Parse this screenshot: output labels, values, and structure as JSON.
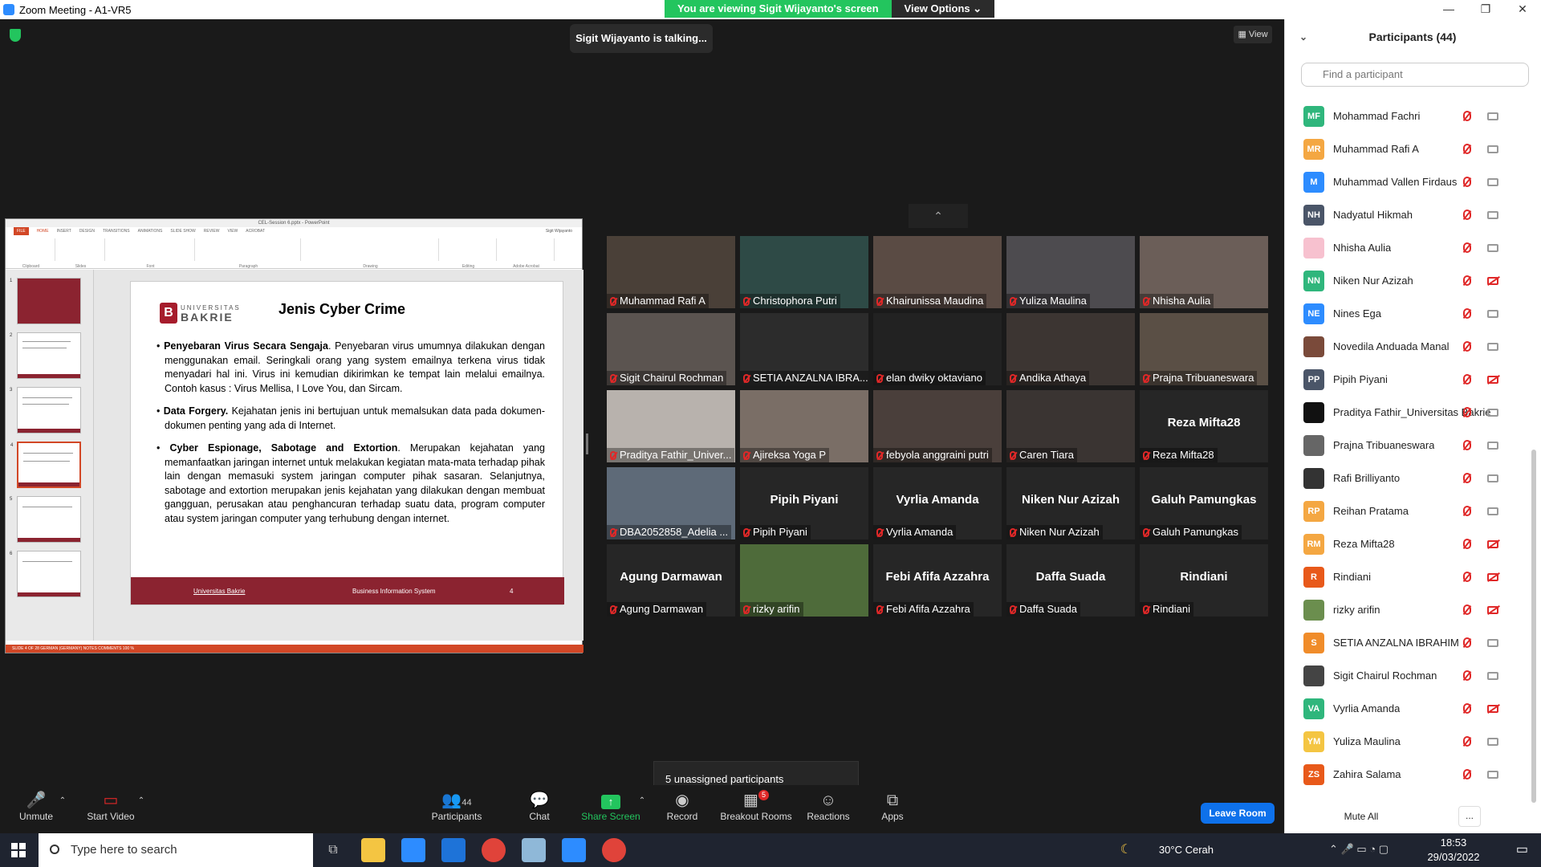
{
  "window": {
    "title": "Zoom Meeting - A1-VR5",
    "minimize": "—",
    "restore": "❐",
    "close": "✕"
  },
  "banner": {
    "viewing": "You are viewing Sigit Wijayanto's screen",
    "view_options": "View Options ⌄"
  },
  "talking": "Sigit Wijayanto is talking...",
  "view_button": "View",
  "share": {
    "app_title": "CEL-Session 6.pptx - PowerPoint",
    "ribbon_tabs": [
      "FILE",
      "HOME",
      "INSERT",
      "DESIGN",
      "TRANSITIONS",
      "ANIMATIONS",
      "SLIDE SHOW",
      "REVIEW",
      "VIEW",
      "ACROBAT"
    ],
    "user": "Sigit Wijayanto",
    "ribbon_groups": [
      "Clipboard",
      "Slides",
      "Font",
      "Paragraph",
      "Drawing",
      "Editing",
      "Adobe Acrobat"
    ],
    "logo_small": "UNIVERSITAS",
    "logo_big": "BAKRIE",
    "slide_title": "Jenis Cyber Crime",
    "bullets": [
      {
        "head": "Penyebaran Virus Secara Sengaja",
        "body": ". Penyebaran virus umumnya dilakukan dengan menggunakan email. Seringkali orang yang system emailnya terkena virus tidak menyadari hal ini. Virus ini kemudian dikirimkan ke tempat lain melalui emailnya. Contoh kasus : Virus Mellisa, I Love You, dan Sircam."
      },
      {
        "head": "Data Forgery.",
        "body": " Kejahatan jenis ini bertujuan untuk memalsukan data pada dokumen-dokumen penting yang ada di Internet."
      },
      {
        "head": "Cyber Espionage, Sabotage and Extortion",
        "body": ". Merupakan kejahatan yang memanfaatkan jaringan internet untuk melakukan kegiatan mata-mata terhadap pihak lain dengan memasuki system jaringan computer pihak sasaran. Selanjutnya, sabotage and extortion merupakan jenis kejahatan yang dilakukan dengan membuat gangguan, perusakan atau penghancuran terhadap suatu data, program computer atau system jaringan computer yang terhubung dengan internet."
      }
    ],
    "footer_left": "Universitas Bakrie",
    "footer_mid": "Business Information System",
    "footer_page": "4",
    "status": "SLIDE 4 OF 28    GERMAN (GERMANY)                                                                                         NOTES    COMMENTS                    100 %",
    "thumb_numbers": [
      "1",
      "2",
      "3",
      "4",
      "5",
      "6"
    ]
  },
  "gallery": [
    {
      "label": "Muhammad Rafi A",
      "big": "",
      "color": "#4a4038"
    },
    {
      "label": "Christophora Putri",
      "big": "",
      "color": "#2e4a46"
    },
    {
      "label": "Khairunissa Maudina",
      "big": "",
      "color": "#5a4b44"
    },
    {
      "label": "Yuliza Maulina",
      "big": "",
      "color": "#4d4b4f"
    },
    {
      "label": "Nhisha Aulia",
      "big": "",
      "color": "#6b5e58"
    },
    {
      "label": "Sigit Chairul Rochman",
      "big": "",
      "color": "#5b5450"
    },
    {
      "label": "SETIA ANZALNA IBRA...",
      "big": "",
      "color": "#2c2c2c"
    },
    {
      "label": "elan dwiky oktaviano",
      "big": "",
      "color": "#222222"
    },
    {
      "label": "Andika Athaya",
      "big": "",
      "color": "#3c3532"
    },
    {
      "label": "Prajna Tribuaneswara",
      "big": "",
      "color": "#5a4f45"
    },
    {
      "label": "Praditya Fathir_Univer...",
      "big": "",
      "color": "#b8b2ad"
    },
    {
      "label": "Ajireksa Yoga P",
      "big": "",
      "color": "#7a6e66"
    },
    {
      "label": "febyola anggraini putri",
      "big": "",
      "color": "#4a3f3b"
    },
    {
      "label": "Caren Tiara",
      "big": "",
      "color": "#3a3432"
    },
    {
      "label": "Reza Mifta28",
      "big": "Reza Mifta28",
      "color": "#262626"
    },
    {
      "label": "DBA2052858_Adelia ...",
      "big": "",
      "color": "#5e6a78"
    },
    {
      "label": "Pipih Piyani",
      "big": "Pipih Piyani",
      "color": "#262626"
    },
    {
      "label": "Vyrlia Amanda",
      "big": "Vyrlia Amanda",
      "color": "#262626"
    },
    {
      "label": "Niken Nur Azizah",
      "big": "Niken Nur Azizah",
      "color": "#262626"
    },
    {
      "label": "Galuh Pamungkas",
      "big": "Galuh Pamungkas",
      "color": "#262626"
    },
    {
      "label": "Agung Darmawan",
      "big": "Agung Darmawan",
      "color": "#262626"
    },
    {
      "label": "rizky arifin",
      "big": "",
      "color": "#4e6b3a"
    },
    {
      "label": "Febi Afifa Azzahra",
      "big": "Febi Afifa Azzahra",
      "color": "#262626"
    },
    {
      "label": "Daffa Suada",
      "big": "Daffa Suada",
      "color": "#262626"
    },
    {
      "label": "Rindiani",
      "big": "Rindiani",
      "color": "#262626"
    }
  ],
  "collapse_icon": "⌃",
  "unassigned": "5 unassigned participants",
  "toolbar": {
    "unmute": "Unmute",
    "start_video": "Start Video",
    "participants": "Participants",
    "participants_count": "44",
    "chat": "Chat",
    "share_screen": "Share Screen",
    "record": "Record",
    "breakout": "Breakout Rooms",
    "breakout_badge": "5",
    "reactions": "Reactions",
    "apps": "Apps",
    "leave": "Leave Room"
  },
  "panel": {
    "title": "Participants (44)",
    "search_placeholder": "Find a participant",
    "mute_all": "Mute All",
    "more": "...",
    "participants": [
      {
        "initials": "MF",
        "name": "Mohammad Fachri",
        "color": "#2fb67c",
        "video_off": false
      },
      {
        "initials": "MR",
        "name": "Muhammad Rafi A",
        "color": "#f4a742",
        "video_off": false
      },
      {
        "initials": "M",
        "name": "Muhammad Vallen Firdaus",
        "color": "#2d8cff",
        "video_off": false
      },
      {
        "initials": "NH",
        "name": "Nadyatul Hikmah",
        "color": "#4a5568",
        "video_off": false
      },
      {
        "initials": "",
        "name": "Nhisha Aulia",
        "color": "#f7c1cf",
        "video_off": false
      },
      {
        "initials": "NN",
        "name": "Niken Nur Azizah",
        "color": "#2fb67c",
        "video_off": true
      },
      {
        "initials": "NE",
        "name": "Nines Ega",
        "color": "#2d8cff",
        "video_off": false
      },
      {
        "initials": "",
        "name": "Novedila Anduada Manal",
        "color": "#7a4a3a",
        "video_off": false
      },
      {
        "initials": "PP",
        "name": "Pipih Piyani",
        "color": "#4a5568",
        "video_off": true
      },
      {
        "initials": "",
        "name": "Praditya Fathir_Universitas Bakrie",
        "color": "#111111",
        "video_off": false
      },
      {
        "initials": "",
        "name": "Prajna Tribuaneswara",
        "color": "#666666",
        "video_off": false
      },
      {
        "initials": "",
        "name": "Rafi Brilliyanto",
        "color": "#333333",
        "video_off": false
      },
      {
        "initials": "RP",
        "name": "Reihan Pratama",
        "color": "#f4a742",
        "video_off": false
      },
      {
        "initials": "RM",
        "name": "Reza Mifta28",
        "color": "#f4a742",
        "video_off": true
      },
      {
        "initials": "R",
        "name": "Rindiani",
        "color": "#e8591a",
        "video_off": true
      },
      {
        "initials": "",
        "name": "rizky arifin",
        "color": "#6b8e4e",
        "video_off": true
      },
      {
        "initials": "S",
        "name": "SETIA ANZALNA IBRAHIM",
        "color": "#f08c2a",
        "video_off": false
      },
      {
        "initials": "",
        "name": "Sigit Chairul Rochman",
        "color": "#444444",
        "video_off": false
      },
      {
        "initials": "VA",
        "name": "Vyrlia Amanda",
        "color": "#2fb67c",
        "video_off": true
      },
      {
        "initials": "YM",
        "name": "Yuliza Maulina",
        "color": "#f4c542",
        "video_off": false
      },
      {
        "initials": "ZS",
        "name": "Zahira Salama",
        "color": "#e8591a",
        "video_off": false
      }
    ]
  },
  "taskbar": {
    "search": "Type here to search",
    "weather": "30°C  Cerah",
    "time": "18:53",
    "date": "29/03/2022"
  }
}
